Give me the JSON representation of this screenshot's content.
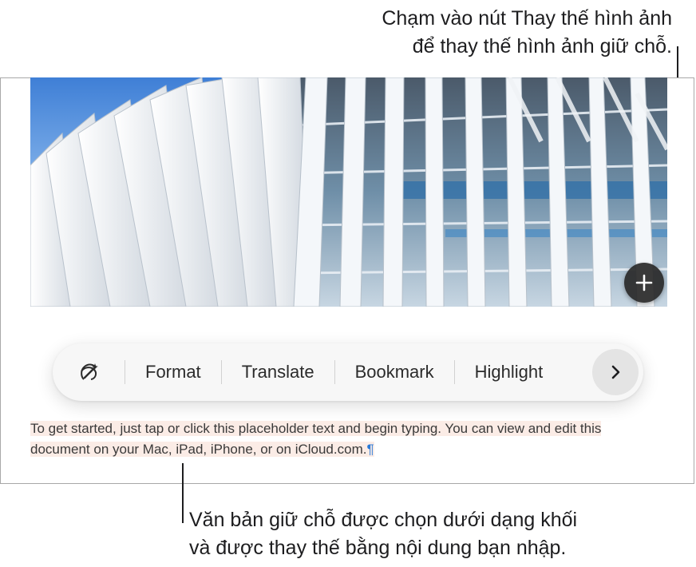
{
  "callouts": {
    "top": {
      "line1": "Chạm vào nút Thay thế hình ảnh",
      "line2": "để thay thế hình ảnh giữ chỗ."
    },
    "bottom": {
      "line1": "Văn bản giữ chỗ được chọn dưới dạng khối",
      "line2": "và được thay thế bằng nội dung bạn nhập."
    }
  },
  "image": {
    "replace_button_icon": "plus-icon"
  },
  "toolbar": {
    "writing_tools_icon": "writing-tools-icon",
    "items": [
      "Format",
      "Translate",
      "Bookmark",
      "Highlight"
    ],
    "more_icon": "chevron-right-icon"
  },
  "document": {
    "placeholder_text": "To get started, just tap or click this placeholder text and begin typing. You can view and edit this document on your Mac, iPad, iPhone, or on iCloud.com.",
    "paragraph_mark": "¶"
  },
  "colors": {
    "selection_highlight": "#fbece6",
    "paragraph_mark": "#2a7ad8",
    "toolbar_bg": "#f7f7f7"
  }
}
